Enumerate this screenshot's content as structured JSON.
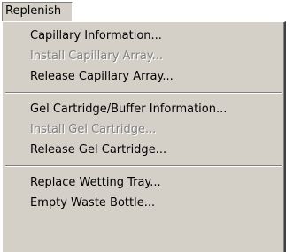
{
  "menu": {
    "title": "Replenish",
    "groups": [
      [
        {
          "label": "Capillary Information...",
          "enabled": true
        },
        {
          "label": "Install Capillary Array...",
          "enabled": false
        },
        {
          "label": "Release Capillary Array...",
          "enabled": true
        }
      ],
      [
        {
          "label": "Gel Cartridge/Buffer Information...",
          "enabled": true
        },
        {
          "label": "Install Gel Cartridge...",
          "enabled": false
        },
        {
          "label": "Release Gel Cartridge...",
          "enabled": true
        }
      ],
      [
        {
          "label": "Replace Wetting Tray...",
          "enabled": true
        },
        {
          "label": "Empty Waste Bottle...",
          "enabled": true
        }
      ]
    ]
  },
  "colors": {
    "menu_background": "#d4d0c8",
    "disabled_text": "#808080",
    "enabled_text": "#000000"
  }
}
